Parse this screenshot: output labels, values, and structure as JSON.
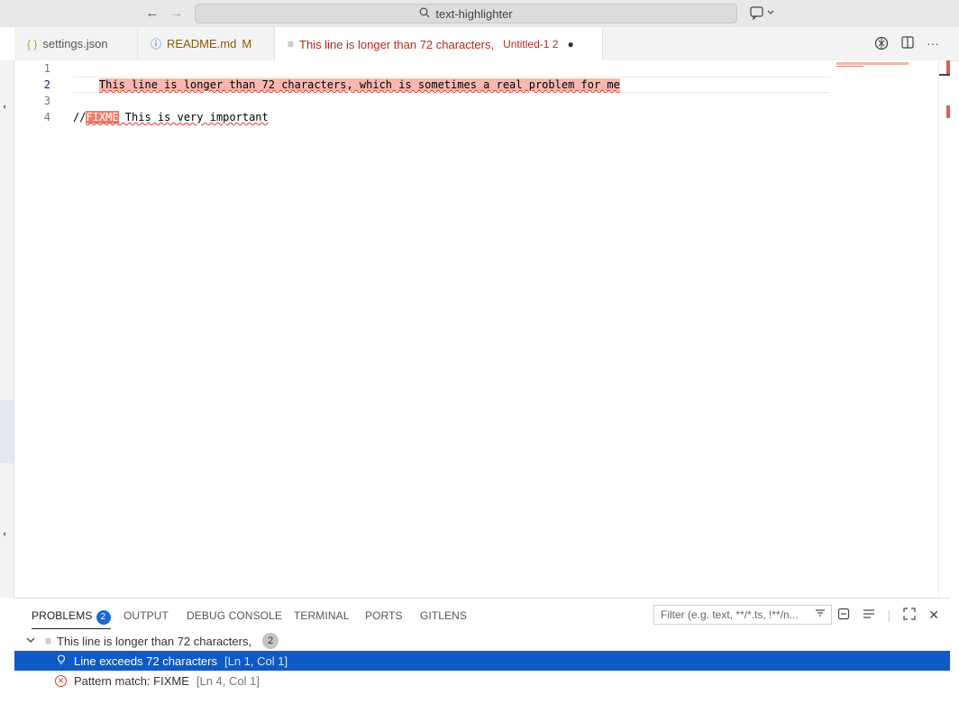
{
  "titlebar": {
    "search_text": "text-highlighter"
  },
  "tabs": [
    {
      "icon": "{ }",
      "label": "settings.json",
      "suffix": ""
    },
    {
      "icon": "ⓘ",
      "label": "README.md",
      "suffix": "M"
    },
    {
      "icon": "≡",
      "label": "This line is longer than 72 characters,",
      "suffix": "Untitled-1 2"
    }
  ],
  "editor": {
    "line_numbers": [
      "1",
      "2",
      "3",
      "4"
    ],
    "line1": "This line is longer than 72 characters, which is sometimes a real problem for me",
    "line4_prefix": "//",
    "line4_keyword": "FIXME",
    "line4_rest": " This is very important"
  },
  "panel": {
    "tabs": [
      "PROBLEMS",
      "OUTPUT",
      "DEBUG CONSOLE",
      "TERMINAL",
      "PORTS",
      "GITLENS"
    ],
    "problems_count": "2",
    "filter_placeholder": "Filter (e.g. text, **/*.ts, !**/n...",
    "group_label": "This line is longer than 72 characters,",
    "group_count": "2",
    "problems": [
      {
        "message": "Line exceeds 72 characters",
        "location": "[Ln 1, Col 1]"
      },
      {
        "message": "Pattern match: FIXME",
        "location": "[Ln 4, Col 1]"
      }
    ]
  },
  "colors": {
    "accent": "#0e5ac6",
    "error": "#d9392c",
    "highlight": "#f8b7b0"
  }
}
